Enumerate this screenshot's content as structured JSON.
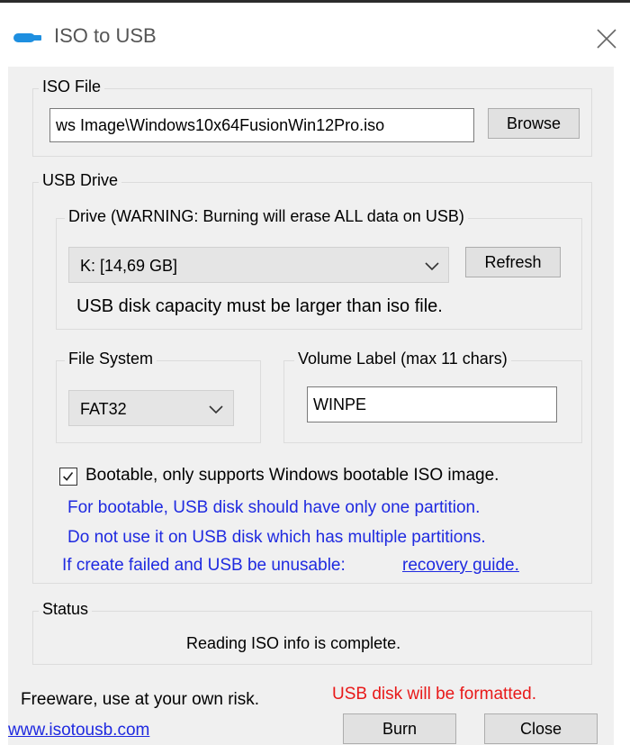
{
  "window": {
    "title": "ISO to USB",
    "close_icon": "close-icon",
    "app_icon": "usb-drive-icon"
  },
  "iso_file": {
    "group_label": "ISO File",
    "path_value": "ws Image\\Windows10x64FusionWin12Pro.iso",
    "browse_label": "Browse"
  },
  "usb_drive": {
    "group_label": "USB Drive",
    "drive": {
      "group_label": "Drive (WARNING: Burning will erase ALL data on USB)",
      "selected": "K: [14,69 GB]",
      "refresh_label": "Refresh",
      "capacity_note": "USB disk capacity must be larger than iso file."
    },
    "file_system": {
      "group_label": "File System",
      "selected": "FAT32"
    },
    "volume_label": {
      "group_label": "Volume Label (max 11 chars)",
      "value": "WINPE"
    },
    "bootable": {
      "checked": true,
      "label": "Bootable, only supports Windows bootable ISO image."
    },
    "notes": [
      "For bootable, USB disk should have only one partition.",
      "Do not use it on USB disk which has multiple partitions."
    ],
    "failed_note": "If create failed and USB be unusable:",
    "recovery_link": "recovery guide."
  },
  "status": {
    "group_label": "Status",
    "message": "Reading ISO info is complete."
  },
  "footer": {
    "freeware": "Freeware, use at your own risk.",
    "website": "www.isotousb.com",
    "warning": "USB disk will be formatted.",
    "burn_label": "Burn",
    "close_label": "Close"
  },
  "colors": {
    "info_blue": "#1f2ae0",
    "warning_red": "#e81919",
    "dialog_bg": "#f0f0f0",
    "icon_blue": "#1e8fe0"
  }
}
